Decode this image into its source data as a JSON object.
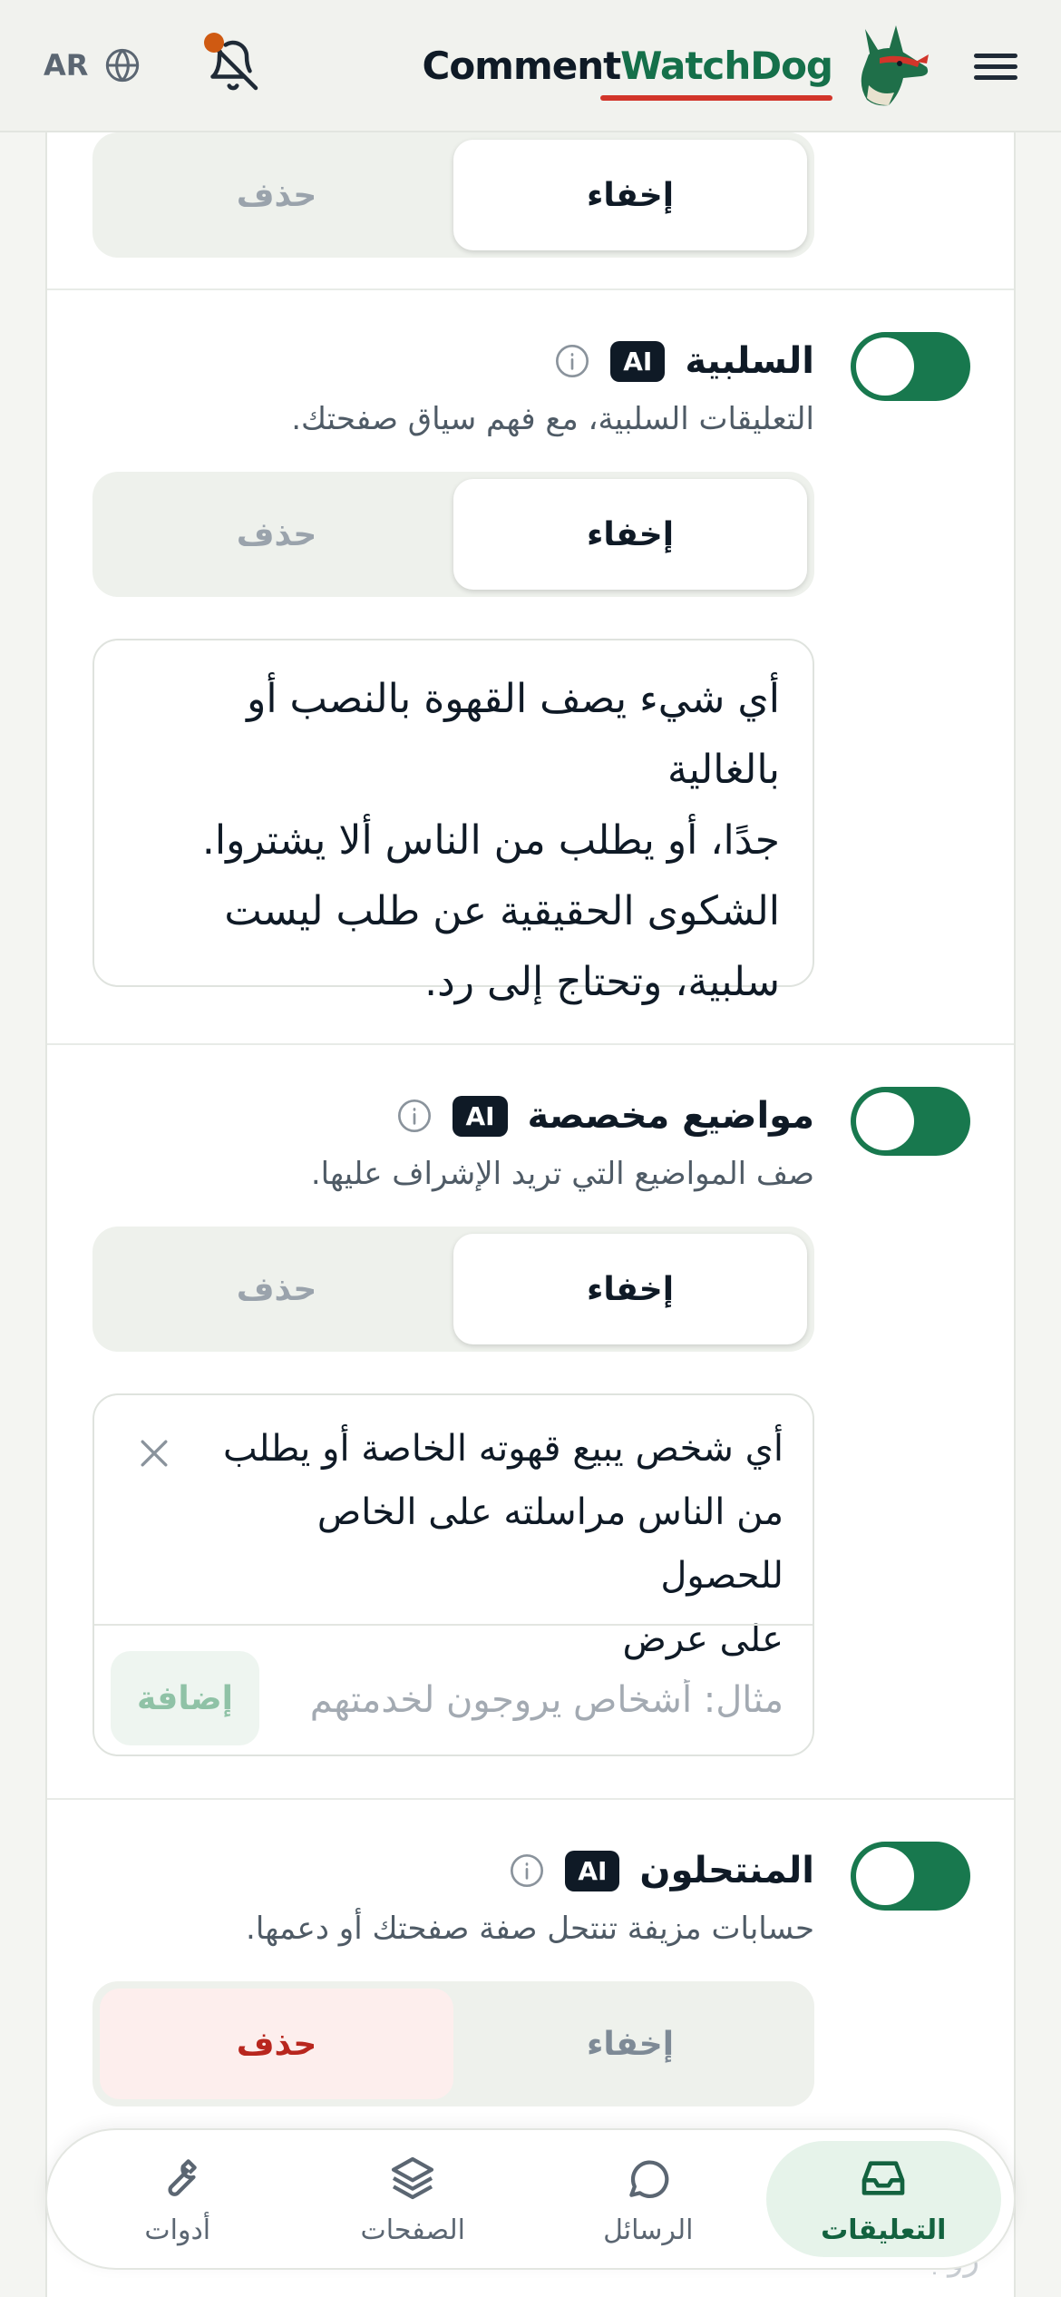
{
  "header": {
    "lang": "AR",
    "brand_part1": "Comment",
    "brand_part2": "WatchDog",
    "colors": {
      "brand_green": "#15704a",
      "underline_red": "#d2352a",
      "notification_dot": "#cf5a12"
    }
  },
  "sections": {
    "top": {
      "hide_label": "إخفاء",
      "delete_label": "حذف"
    },
    "negative": {
      "title": "السلبية",
      "badge": "AI",
      "description": "التعليقات السلبية، مع فهم سياق صفحتك.",
      "hide_label": "إخفاء",
      "delete_label": "حذف",
      "prompt_lines": [
        "أي شيء يصف القهوة بالنصب أو بالغالية",
        "جدًا، أو يطلب من الناس ألا يشتروا.",
        "الشكوى الحقيقية عن طلب ليست",
        "سلبية، وتحتاج إلى رد."
      ]
    },
    "custom": {
      "title": "مواضيع مخصصة",
      "badge": "AI",
      "description": "صف المواضيع التي تريد الإشراف عليها.",
      "hide_label": "إخفاء",
      "delete_label": "حذف",
      "topic_lines": [
        "أي شخص يبيع قهوته الخاصة أو يطلب",
        "من الناس مراسلته على الخاص للحصول",
        "على عرض"
      ],
      "input_placeholder": "مثال: أشخاص يروجون لخدمتهم",
      "add_label": "إضافة"
    },
    "impersonators": {
      "title": "المنتحلون",
      "badge": "AI",
      "description": "حسابات مزيفة تنتحل صفة صفحتك أو دعمها.",
      "hide_label": "إخفاء",
      "delete_label": "حذف"
    }
  },
  "bottom_nav": [
    {
      "label": "التعليقات",
      "icon": "inbox-icon",
      "active": true
    },
    {
      "label": "الرسائل",
      "icon": "chat-bubble-icon",
      "active": false
    },
    {
      "label": "الصفحات",
      "icon": "layers-icon",
      "active": false
    },
    {
      "label": "أدوات",
      "icon": "wrench-icon",
      "active": false
    }
  ],
  "peek_text": "روابط"
}
